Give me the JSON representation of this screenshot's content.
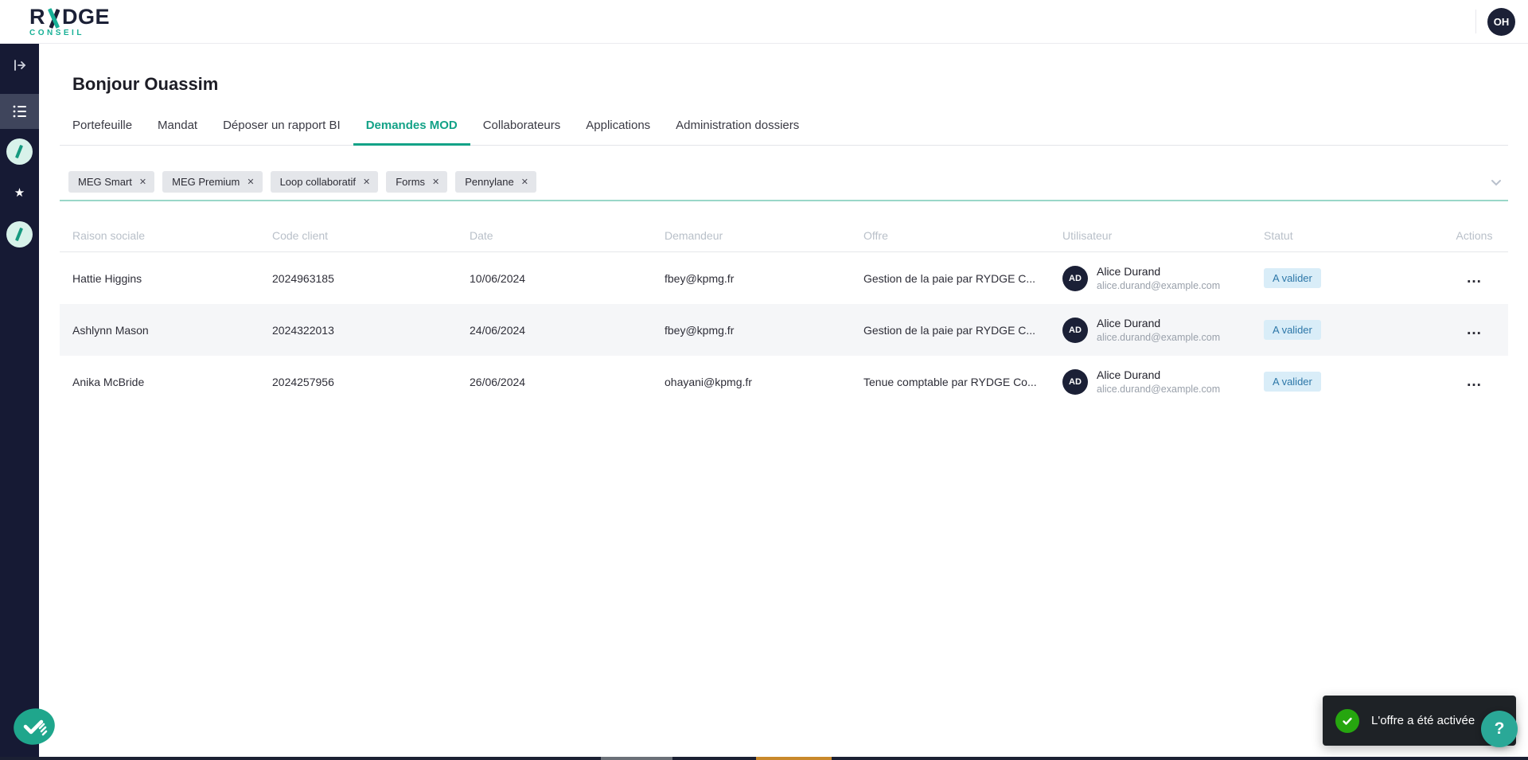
{
  "topbar": {
    "logo_text_left": "R",
    "logo_text_right": "DGE",
    "logo_sub": "CONSEIL",
    "avatar_initials": "OH"
  },
  "sidebar": {
    "items": [
      "expand-panel",
      "requests-list",
      "app-link",
      "favorites",
      "app-link"
    ]
  },
  "page": {
    "greeting": "Bonjour Ouassim"
  },
  "tabs": {
    "items": [
      {
        "label": "Portefeuille",
        "active": false
      },
      {
        "label": "Mandat",
        "active": false
      },
      {
        "label": "Déposer un rapport BI",
        "active": false
      },
      {
        "label": "Demandes MOD",
        "active": true
      },
      {
        "label": "Collaborateurs",
        "active": false
      },
      {
        "label": "Applications",
        "active": false
      },
      {
        "label": "Administration dossiers",
        "active": false
      }
    ]
  },
  "filters": {
    "chips": [
      "MEG Smart",
      "MEG Premium",
      "Loop collaboratif",
      "Forms",
      "Pennylane"
    ]
  },
  "table": {
    "columns": [
      "Raison sociale",
      "Code client",
      "Date",
      "Demandeur",
      "Offre",
      "Utilisateur",
      "Statut",
      "Actions"
    ],
    "rows": [
      {
        "raison_sociale": "Hattie Higgins",
        "code_client": "2024963185",
        "date": "10/06/2024",
        "demandeur": "fbey@kpmg.fr",
        "offre": "Gestion de la paie par RYDGE C...",
        "user_initials": "AD",
        "user_name": "Alice Durand",
        "user_email": "alice.durand@example.com",
        "statut": "A valider"
      },
      {
        "raison_sociale": "Ashlynn Mason",
        "code_client": "2024322013",
        "date": "24/06/2024",
        "demandeur": "fbey@kpmg.fr",
        "offre": "Gestion de la paie par RYDGE C...",
        "user_initials": "AD",
        "user_name": "Alice Durand",
        "user_email": "alice.durand@example.com",
        "statut": "A valider"
      },
      {
        "raison_sociale": "Anika McBride",
        "code_client": "2024257956",
        "date": "26/06/2024",
        "demandeur": "ohayani@kpmg.fr",
        "offre": "Tenue comptable par RYDGE Co...",
        "user_initials": "AD",
        "user_name": "Alice Durand",
        "user_email": "alice.durand@example.com",
        "statut": "A valider"
      }
    ]
  },
  "toast": {
    "message": "L'offre a été activée"
  },
  "help": {
    "label": "?"
  },
  "icons": {
    "more_actions": "...",
    "close": "✕",
    "star": "★"
  },
  "colors": {
    "accent_teal": "#13a287",
    "underline_teal": "#9ad7c8",
    "sidebar_navy": "#161a34",
    "badge_bg": "#d9edf8",
    "badge_text": "#2d77a8",
    "toast_bg": "#1e2226",
    "toast_green": "#26a60f",
    "help_teal": "#2aa897",
    "avatar_navy": "#1b2036"
  }
}
